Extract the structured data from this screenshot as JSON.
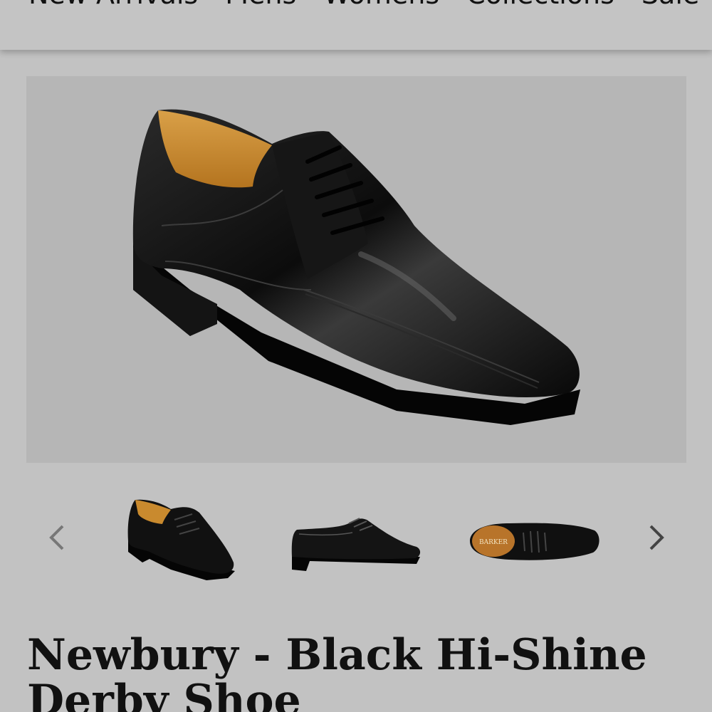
{
  "nav": {
    "items": [
      "New Arrivals",
      "Mens",
      "Womens",
      "Collections",
      "Sale"
    ]
  },
  "hero": {
    "image": "black-derby-shoe-three-quarter-view",
    "background": "#b6b6b6"
  },
  "thumbnails": [
    {
      "image": "shoe-side-angle"
    },
    {
      "image": "shoe-profile"
    },
    {
      "image": "shoe-top-view",
      "logo_text": "BARKER"
    }
  ],
  "carousel": {
    "prev_icon": "chevron-left-icon",
    "next_icon": "chevron-right-icon"
  },
  "product": {
    "title": "Newbury - Black Hi-Shine Derby Shoe"
  },
  "colors": {
    "page_bg": "#c2c2c2",
    "shoe_black": "#0b0b0b",
    "lining_tan": "#c98a2e"
  }
}
